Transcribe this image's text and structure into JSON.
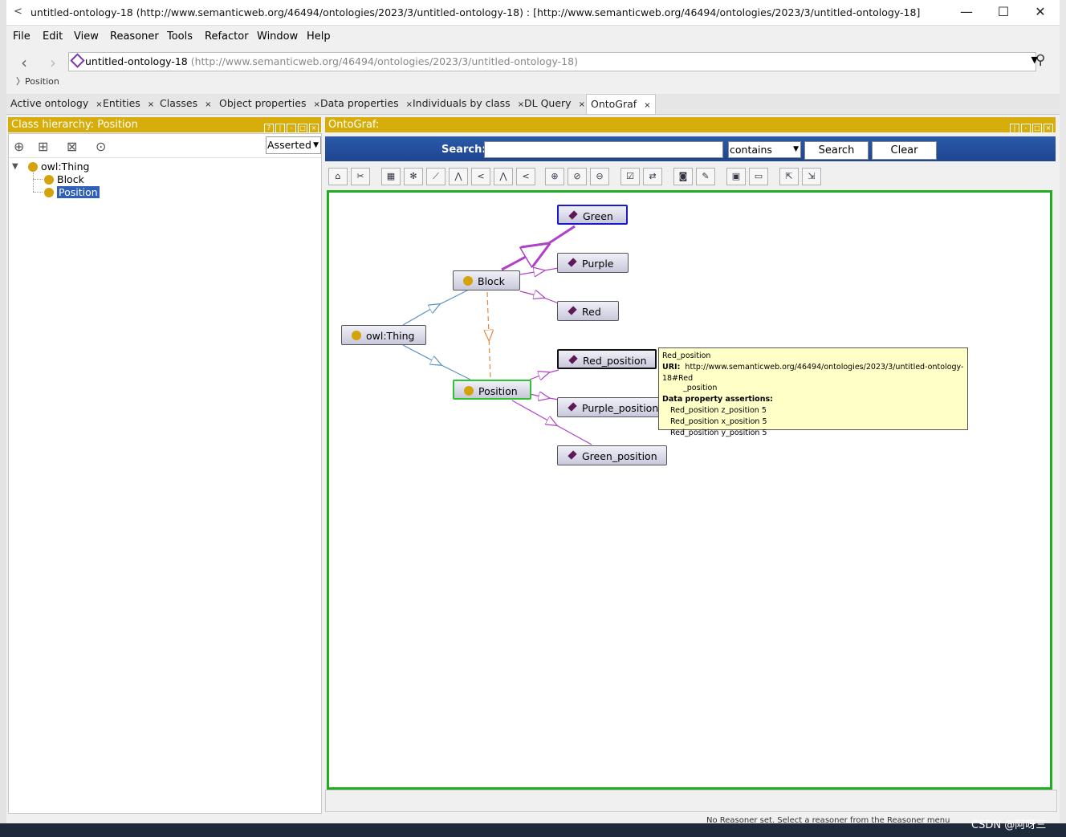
{
  "window": {
    "title": "untitled-ontology-18 (http://www.semanticweb.org/46494/ontologies/2023/3/untitled-ontology-18)  : [http://www.semanticweb.org/46494/ontologies/2023/3/untitled-ontology-18]",
    "minimize": "—",
    "maximize": "☐",
    "close": "✕"
  },
  "menu": [
    "File",
    "Edit",
    "View",
    "Reasoner",
    "Tools",
    "Refactor",
    "Window",
    "Help"
  ],
  "address": {
    "ontology_name": "untitled-ontology-18",
    "ontology_iri": "(http://www.semanticweb.org/46494/ontologies/2023/3/untitled-ontology-18)",
    "breadcrumb": "Position"
  },
  "tabs": [
    {
      "label": "Active ontology",
      "close": "×"
    },
    {
      "label": "Entities",
      "close": "×"
    },
    {
      "label": "Classes",
      "close": "×"
    },
    {
      "label": "Object properties",
      "close": "×"
    },
    {
      "label": "Data properties",
      "close": "×"
    },
    {
      "label": "Individuals by class",
      "close": "×"
    },
    {
      "label": "DL Query",
      "close": "×"
    },
    {
      "label": "OntoGraf",
      "close": "×",
      "active": true
    }
  ],
  "class_hierarchy": {
    "title": "Class hierarchy: Position",
    "mode": "Asserted",
    "root": "owl:Thing",
    "children": [
      "Block",
      "Position"
    ],
    "selected": "Position"
  },
  "ontograf": {
    "title": "OntoGraf:",
    "search_label": "Search:",
    "search_value": "",
    "match_mode": "contains",
    "search_button": "Search",
    "clear_button": "Clear",
    "nodes": {
      "owl_thing": "owl:Thing",
      "block": "Block",
      "position": "Position",
      "green": "Green",
      "purple": "Purple",
      "red": "Red",
      "red_position": "Red_position",
      "purple_position": "Purple_position",
      "green_position": "Green_position"
    },
    "tooltip": {
      "name": "Red_position",
      "uri_label": "URI:",
      "uri_line1": "http://www.semanticweb.org/46494/ontologies/2023/3/untitled-ontology-18#Red",
      "uri_line2": "_position",
      "assertions_label": "Data property assertions:",
      "assertions": [
        "Red_position z_position 5",
        "Red_position x_position 5",
        "Red_position y_position 5"
      ]
    }
  },
  "status_text": "No Reasoner set. Select a reasoner from the Reasoner menu",
  "watermark": "CSDN @阿呀三",
  "colors": {
    "panel_title": "#d6ad0a",
    "search_bar": "#1e4590",
    "graph_border": "#1fae1f",
    "class_dot": "#d4a20a",
    "individual_diamond": "#5b1a55",
    "subclass_edge": "#5a8fc8",
    "instance_edge": "#b040c8",
    "dashed_edge": "#e08a40",
    "tooltip_bg": "#ffffc8"
  }
}
